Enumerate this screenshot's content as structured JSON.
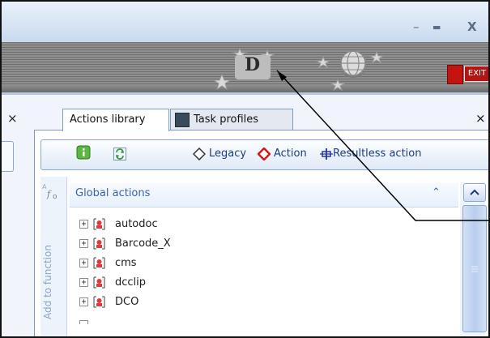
{
  "window": {
    "controls": {
      "minimize": "–",
      "maximize": "▬",
      "close": "X"
    }
  },
  "toolbar": {
    "d_button_label": "D",
    "exit_label": "EXIT"
  },
  "left": {
    "close": "×"
  },
  "tabs": [
    {
      "label": "Actions library",
      "active": true
    },
    {
      "label": "Task profiles",
      "active": false
    }
  ],
  "panel_close": "×",
  "action_bar": {
    "legacy": "Legacy",
    "action": "Action",
    "resultless": "Resultless action"
  },
  "side_label": "Add to function",
  "group": {
    "title": "Global actions",
    "collapse": "⌃"
  },
  "items": [
    {
      "label": "autodoc"
    },
    {
      "label": "Barcode_X"
    },
    {
      "label": "cms"
    },
    {
      "label": "dcclip"
    },
    {
      "label": "DCO"
    }
  ],
  "icons": {
    "info": "info-icon",
    "refresh": "refresh-icon",
    "legacy": "diamond-outline-icon",
    "action": "red-diamond-icon",
    "resultless": "blue-hook-icon"
  }
}
